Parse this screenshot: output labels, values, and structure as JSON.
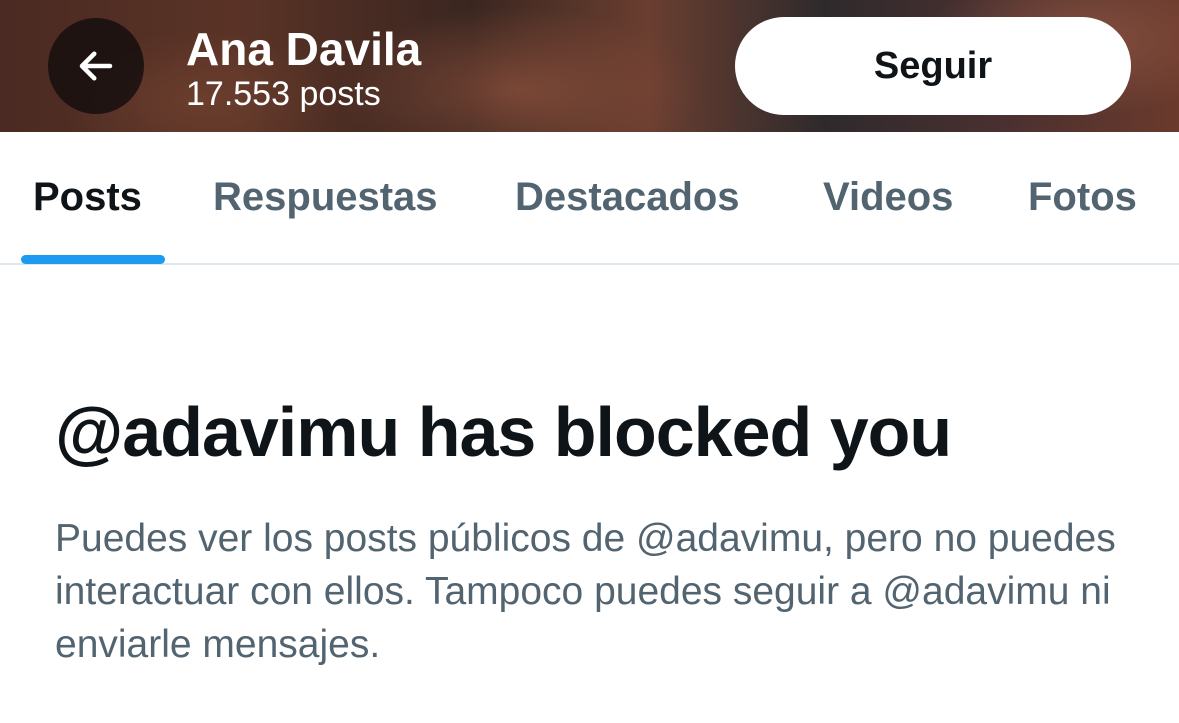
{
  "header": {
    "back_icon": "arrow-left-icon",
    "name": "Ana Davila",
    "post_count": "17.553 posts",
    "follow_label": "Seguir"
  },
  "tabs": [
    {
      "label": "Posts",
      "active": true
    },
    {
      "label": "Respuestas",
      "active": false
    },
    {
      "label": "Destacados",
      "active": false
    },
    {
      "label": "Videos",
      "active": false
    },
    {
      "label": "Fotos",
      "active": false
    }
  ],
  "blocked": {
    "title": "@adavimu has blocked you",
    "description": "Puedes ver los posts públicos de @adavimu, pero no puedes interactuar con ellos. Tampoco puedes seguir a @adavimu ni enviarle mensajes."
  },
  "colors": {
    "accent": "#1d9bf0",
    "primary_text": "#0f1419",
    "secondary_text": "#536471"
  }
}
